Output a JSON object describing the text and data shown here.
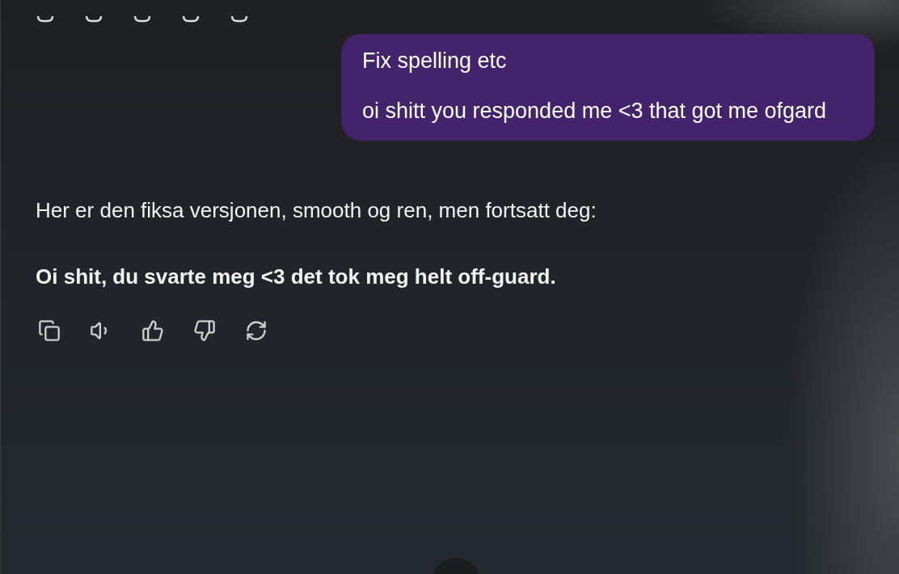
{
  "user_message": {
    "paragraphs": [
      "Fix spelling etc",
      "oi shitt you responded me <3 that got me ofgard"
    ]
  },
  "assistant_message": {
    "paragraphs": [
      {
        "kind": "plain",
        "text": "Her er den fiksa versjonen, smooth og ren, men fortsatt deg:"
      },
      {
        "kind": "bold",
        "text": "Oi shit, du svarte meg <3 det tok meg helt off-guard."
      }
    ]
  }
}
